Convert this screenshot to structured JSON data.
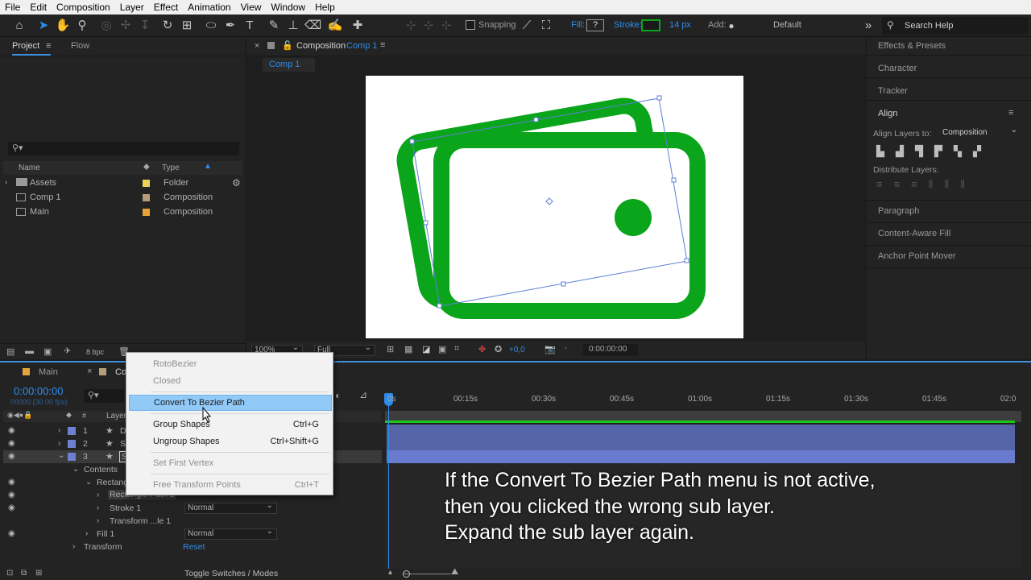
{
  "menu": [
    "File",
    "Edit",
    "Composition",
    "Layer",
    "Effect",
    "Animation",
    "View",
    "Window",
    "Help"
  ],
  "toolbar": {
    "snapping": "Snapping",
    "fill_label": "Fill:",
    "fill_value": "?",
    "stroke_label": "Stroke:",
    "stroke_px": "14 px",
    "add_label": "Add:",
    "workspace": "Default",
    "search_help": "Search Help"
  },
  "project": {
    "tab": "Project",
    "flow_tab": "Flow",
    "col_name": "Name",
    "col_type": "Type",
    "rows": [
      {
        "name": "Assets",
        "type": "Folder",
        "color": "#e8d35b"
      },
      {
        "name": "Comp 1",
        "type": "Composition",
        "color": "#b59d7b"
      },
      {
        "name": "Main",
        "type": "Composition",
        "color": "#e7a43a"
      }
    ],
    "bpc": "8 bpc"
  },
  "composition": {
    "title_prefix": "Composition",
    "comp_name": "Comp 1",
    "crumb": "Comp 1",
    "zoom": "100%",
    "quality": "Full",
    "exposure": "+0,0",
    "timecode": "0:00:00:00"
  },
  "right_panel": {
    "items": [
      "Effects & Presets",
      "Character",
      "Tracker"
    ],
    "align_title": "Align",
    "align_layers_to": "Align Layers to:",
    "align_target": "Composition",
    "distribute": "Distribute Layers:",
    "bottom_items": [
      "Paragraph",
      "Content-Aware Fill",
      "Anchor Point Mover"
    ]
  },
  "timeline": {
    "tab_main": "Main",
    "tab_comp": "Co",
    "timecode": "0:00:00:00",
    "fps": "00000 (30.00 fps)",
    "layer_col": "Layer",
    "layers": [
      {
        "num": "1",
        "name": "D"
      },
      {
        "num": "2",
        "name": "Sh"
      },
      {
        "num": "3",
        "name": "Sh"
      }
    ],
    "contents": "Contents",
    "rectangle": "Rectang",
    "rect_path": "Rectangle Path 1",
    "stroke": "Stroke 1",
    "transform_sub": "Transform ...le 1",
    "fill": "Fill 1",
    "transform": "Transform",
    "reset": "Reset",
    "blend_normal": "Normal",
    "toggle": "Toggle Switches / Modes",
    "ruler": [
      "0s",
      "00:15s",
      "00:30s",
      "00:45s",
      "01:00s",
      "01:15s",
      "01:30s",
      "01:45s",
      "02:0"
    ]
  },
  "context_menu": {
    "items": [
      {
        "label": "RotoBezier",
        "shortcut": "",
        "disabled": true
      },
      {
        "label": "Closed",
        "shortcut": "",
        "disabled": true
      },
      {
        "label": "Convert To Bezier Path",
        "shortcut": "",
        "disabled": false
      },
      {
        "label": "Group Shapes",
        "shortcut": "Ctrl+G",
        "disabled": false
      },
      {
        "label": "Ungroup Shapes",
        "shortcut": "Ctrl+Shift+G",
        "disabled": false
      },
      {
        "label": "Set First Vertex",
        "shortcut": "",
        "disabled": true
      },
      {
        "label": "Free Transform Points",
        "shortcut": "Ctrl+T",
        "disabled": true
      }
    ]
  },
  "caption": {
    "line1": "If the Convert To Bezier Path menu is not active,",
    "line2": "then you clicked the wrong sub layer.",
    "line3": "Expand the sub layer again."
  },
  "colors": {
    "accent": "#2d8ceb",
    "shape_green": "#0aa51b",
    "path_blue": "#5b7fd6",
    "menu_highlight": "#91c9f7",
    "track": "#5565a8"
  }
}
